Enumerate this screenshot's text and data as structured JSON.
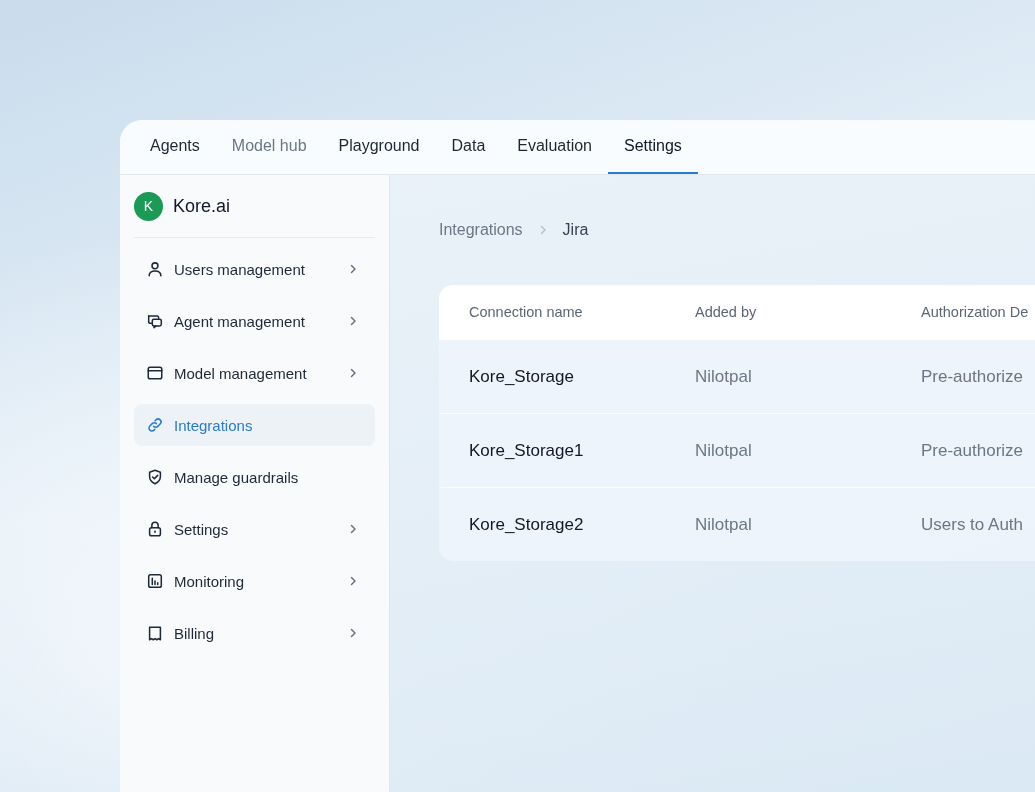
{
  "tabs": [
    {
      "label": "Agents",
      "selected": false,
      "disabled": false
    },
    {
      "label": "Model hub",
      "selected": false,
      "disabled": true
    },
    {
      "label": "Playground",
      "selected": false,
      "disabled": false
    },
    {
      "label": "Data",
      "selected": false,
      "disabled": false
    },
    {
      "label": "Evaluation",
      "selected": false,
      "disabled": false
    },
    {
      "label": "Settings",
      "selected": true,
      "disabled": false
    }
  ],
  "sidebar": {
    "workspace": {
      "initial": "K",
      "name": "Kore.ai"
    },
    "items": [
      {
        "label": "Users management",
        "selected": false,
        "expandable": true
      },
      {
        "label": "Agent management",
        "selected": false,
        "expandable": true
      },
      {
        "label": "Model management",
        "selected": false,
        "expandable": true
      },
      {
        "label": "Integrations",
        "selected": true,
        "expandable": false
      },
      {
        "label": "Manage guardrails",
        "selected": false,
        "expandable": false
      },
      {
        "label": "Settings",
        "selected": false,
        "expandable": true
      },
      {
        "label": "Monitoring",
        "selected": false,
        "expandable": true
      },
      {
        "label": "Billing",
        "selected": false,
        "expandable": true
      }
    ]
  },
  "breadcrumb": [
    "Integrations",
    "Jira"
  ],
  "table": {
    "columns": [
      "Connection name",
      "Added by",
      "Authorization De"
    ],
    "rows": [
      [
        "Kore_Storage",
        "Nilotpal",
        "Pre-authorize"
      ],
      [
        "Kore_Storage1",
        "Nilotpal",
        "Pre-authorize"
      ],
      [
        "Kore_Storage2",
        "Nilotpal",
        "Users to Auth"
      ]
    ]
  }
}
